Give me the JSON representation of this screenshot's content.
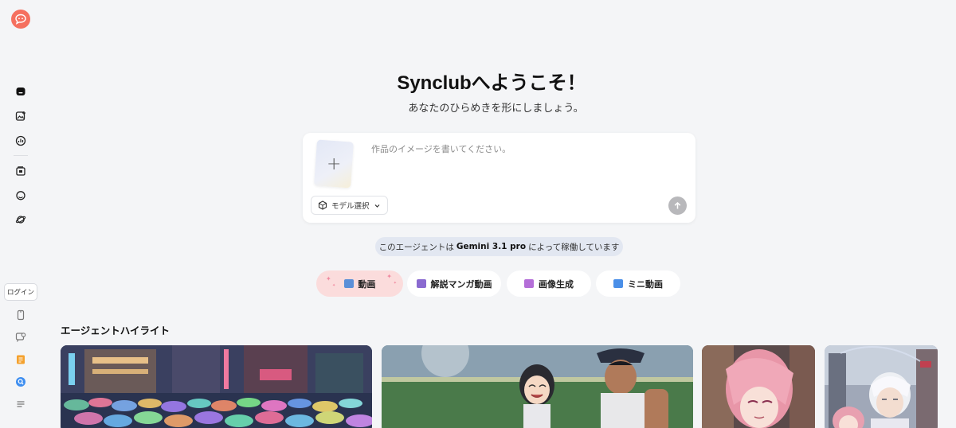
{
  "sidebar": {
    "login_label": "ログイン",
    "icons": [
      "logo-icon",
      "home-icon",
      "image-add-icon",
      "analytics-icon",
      "folder-icon",
      "chat-icon",
      "planet-icon",
      "phone-icon",
      "feedback-icon",
      "note-icon",
      "discord-icon",
      "menu-icon"
    ]
  },
  "hero": {
    "title": "Synclubへようこそ！",
    "subtitle": "あなたのひらめきを形にしましょう。"
  },
  "prompt": {
    "placeholder": "作品のイメージを書いてください。",
    "model_label": "モデル選択"
  },
  "agent": {
    "prefix": "このエージェントは",
    "model": "Gemini 3.1 pro",
    "suffix": "によって稼働しています"
  },
  "categories": [
    {
      "label": "動画",
      "active": true,
      "icon_color": "#5a8fd8"
    },
    {
      "label": "解説マンガ動画",
      "active": false,
      "icon_color": "#8a6ad0"
    },
    {
      "label": "画像生成",
      "active": false,
      "icon_color": "#b46ed8"
    },
    {
      "label": "ミニ動画",
      "active": false,
      "icon_color": "#4a8fe8"
    }
  ],
  "highlights": {
    "title": "エージェントハイライト"
  },
  "colors": {
    "brand": "#f5705f",
    "active_pill": "#fbdcdc",
    "agent_pill": "#e2e7f1"
  }
}
